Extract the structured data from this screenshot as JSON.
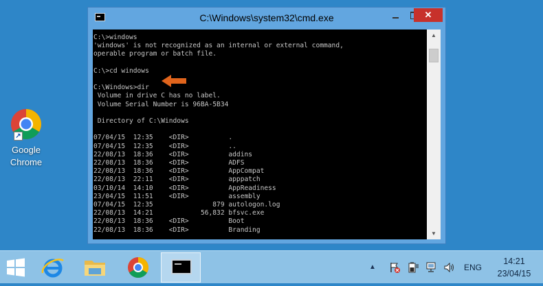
{
  "window": {
    "title": "C:\\Windows\\system32\\cmd.exe",
    "minimize_label": "",
    "maximize_label": "",
    "close_label": "✕"
  },
  "console": {
    "lines": [
      "C:\\>windows",
      "'windows' is not recognized as an internal or external command,",
      "operable program or batch file.",
      "",
      "C:\\>cd windows",
      "",
      "C:\\Windows>dir",
      " Volume in drive C has no label.",
      " Volume Serial Number is 96BA-5B34",
      "",
      " Directory of C:\\Windows",
      "",
      "07/04/15  12:35    <DIR>          .",
      "07/04/15  12:35    <DIR>          ..",
      "22/08/13  18:36    <DIR>          addins",
      "22/08/13  18:36    <DIR>          ADFS",
      "22/08/13  18:36    <DIR>          AppCompat",
      "22/08/13  22:11    <DIR>          apppatch",
      "03/10/14  14:10    <DIR>          AppReadiness",
      "23/04/15  11:51    <DIR>          assembly",
      "07/04/15  12:35               879 autologon.log",
      "22/08/13  14:21            56,832 bfsvc.exe",
      "22/08/13  18:36    <DIR>          Boot",
      "22/08/13  18:36    <DIR>          Branding"
    ]
  },
  "desktop": {
    "icons": [
      {
        "label": "Google Chrome",
        "icon": "chrome-icon"
      }
    ]
  },
  "taskbar": {
    "apps": [
      {
        "name": "start",
        "icon": "windows-logo-icon"
      },
      {
        "name": "internet-explorer",
        "icon": "ie-icon"
      },
      {
        "name": "file-explorer",
        "icon": "folder-icon"
      },
      {
        "name": "chrome",
        "icon": "chrome-icon"
      },
      {
        "name": "command-prompt",
        "icon": "cmd-icon"
      }
    ],
    "tray": {
      "show_hidden_glyph": "▲",
      "language": "ENG",
      "time": "14:21",
      "date": "23/04/15"
    }
  },
  "colors": {
    "desktop": "#2e86c8",
    "taskbar": "#8ec2e6",
    "window_frame": "#62a6e0",
    "close_button": "#c7312b",
    "console_bg": "#000000",
    "console_text": "#c8c8c8",
    "annotation_arrow": "#e0641c"
  }
}
